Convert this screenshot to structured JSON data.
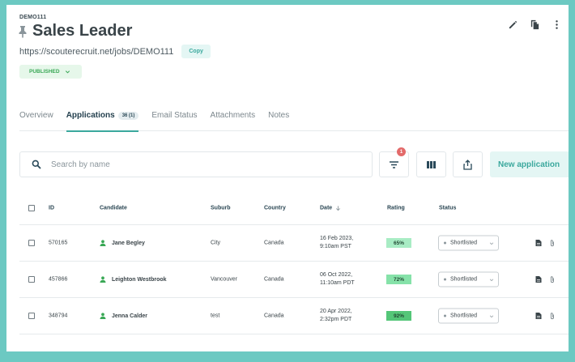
{
  "job": {
    "code": "DEMO111",
    "title": "Sales Leader",
    "url": "https://scouterecruit.net/jobs/DEMO111",
    "copy_label": "Copy",
    "status": "PUBLISHED"
  },
  "tabs": [
    {
      "label": "Overview",
      "active": false
    },
    {
      "label": "Applications",
      "badge": "36 (1)",
      "active": true
    },
    {
      "label": "Email Status",
      "active": false
    },
    {
      "label": "Attachments",
      "active": false
    },
    {
      "label": "Notes",
      "active": false
    }
  ],
  "search": {
    "placeholder": "Search by name",
    "value": ""
  },
  "toolbar": {
    "filter_count": "1",
    "new_application_label": "New application"
  },
  "table": {
    "headers": {
      "id": "ID",
      "candidate": "Candidate",
      "suburb": "Suburb",
      "country": "Country",
      "date": "Date",
      "rating": "Rating",
      "status": "Status"
    },
    "rows": [
      {
        "id": "570165",
        "candidate": "Jane Begley",
        "suburb": "City",
        "country": "Canada",
        "date_line1": "16 Feb 2023,",
        "date_line2": "9:10am PST",
        "rating": "65%",
        "status": "Shortlisted"
      },
      {
        "id": "457866",
        "candidate": "Leighton Westbrook",
        "suburb": "Vancouver",
        "country": "Canada",
        "date_line1": "06 Oct 2022,",
        "date_line2": "11:10am PDT",
        "rating": "72%",
        "status": "Shortlisted"
      },
      {
        "id": "348794",
        "candidate": "Jenna Calder",
        "suburb": "test",
        "country": "Canada",
        "date_line1": "20 Apr 2022,",
        "date_line2": "2:32pm PDT",
        "rating": "92%",
        "status": "Shortlisted"
      }
    ]
  },
  "colors": {
    "frame_border": "#6cc9c2",
    "accent": "#3aa89d",
    "rating_low": "#a8ecc4",
    "rating_mid": "#86e2a9",
    "rating_high": "#54c678",
    "badge_red": "#e36a6a"
  },
  "icons": [
    "pin-icon",
    "pencil-icon",
    "copy-icon",
    "more-vertical-icon",
    "search-icon",
    "filter-icon",
    "columns-icon",
    "export-icon",
    "person-icon",
    "document-icon",
    "paperclip-icon",
    "chevron-down-icon",
    "sort-down-arrow-icon"
  ]
}
